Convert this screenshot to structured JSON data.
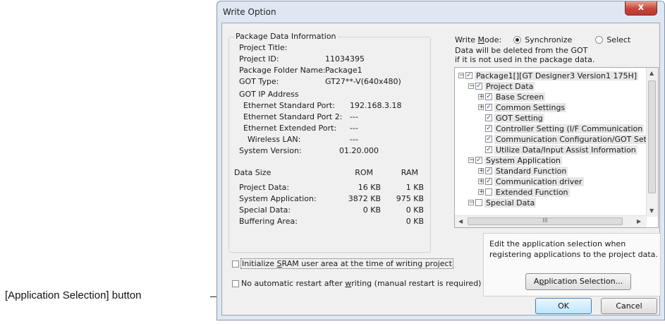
{
  "callout": {
    "text": "[Application Selection] button"
  },
  "dialog": {
    "title": "Write Option",
    "close": "x",
    "package_info": {
      "heading": "Package Data Information",
      "project_title_label": "Project Title:",
      "project_id_label": "Project ID:",
      "project_id_value": "11034395",
      "package_folder_label": "Package Folder Name:",
      "package_folder_value": "Package1",
      "got_type_label": "GOT Type:",
      "got_type_value": "GT27**-V(640x480)",
      "got_ip_label": "GOT IP Address",
      "eth_std_label": "Ethernet Standard Port:",
      "eth_std_value": "192.168.3.18",
      "eth_std2_label": "Ethernet Standard Port 2:",
      "eth_std2_value": "---",
      "eth_ext_label": "Ethernet Extended Port:",
      "eth_ext_value": "---",
      "wlan_label": "Wireless LAN:",
      "wlan_value": "---",
      "sysver_label": "System Version:",
      "sysver_value": "01.20.000"
    },
    "data_size": {
      "heading": "Data Size",
      "col_rom": "ROM",
      "col_ram": "RAM",
      "rows": [
        {
          "label": "Project Data:",
          "rom": "16 KB",
          "ram": "1 KB"
        },
        {
          "label": "System Application:",
          "rom": "3872 KB",
          "ram": "975 KB"
        },
        {
          "label": "Special Data:",
          "rom": "0 KB",
          "ram": "0 KB"
        },
        {
          "label": "Buffering Area:",
          "rom": "",
          "ram": "0 KB"
        }
      ]
    },
    "write_mode": {
      "label_pre": "Write ",
      "label_key": "M",
      "label_post": "ode:",
      "options": [
        "Synchronize",
        "Select"
      ],
      "selected": "Synchronize",
      "note_line1": "Data will be deleted from the GOT",
      "note_line2": "if it is not used in the package data."
    },
    "tree": [
      {
        "label": "Package1[][GT Designer3 Version1 175H]",
        "level": 0,
        "expander": "-",
        "checked": true
      },
      {
        "label": "Project Data",
        "level": 1,
        "expander": "-",
        "checked": true
      },
      {
        "label": "Base Screen",
        "level": 2,
        "expander": "+",
        "checked": true
      },
      {
        "label": "Common Settings",
        "level": 2,
        "expander": "+",
        "checked": true
      },
      {
        "label": "GOT Setting",
        "level": 2,
        "expander": "",
        "checked": true
      },
      {
        "label": "Controller Setting (I/F Communication",
        "level": 2,
        "expander": "",
        "checked": true
      },
      {
        "label": "Communication Configuration/GOT Set",
        "level": 2,
        "expander": "",
        "checked": true
      },
      {
        "label": "Utilize Data/Input Assist Information",
        "level": 2,
        "expander": "",
        "checked": true
      },
      {
        "label": "System Application",
        "level": 1,
        "expander": "-",
        "checked": true
      },
      {
        "label": "Standard Function",
        "level": 2,
        "expander": "+",
        "checked": true
      },
      {
        "label": "Communication driver",
        "level": 2,
        "expander": "+",
        "checked": true
      },
      {
        "label": "Extended Function",
        "level": 2,
        "expander": "+",
        "checked": false
      },
      {
        "label": "Special Data",
        "level": 1,
        "expander": "-",
        "checked": false
      }
    ],
    "scroll_thumb_grip": "III",
    "help_text": "Edit the application selection when registering applications to the project data.",
    "app_select_pre": "A",
    "app_select_key": "p",
    "app_select_post": "plication Selection...",
    "sram_pre": "Initialize ",
    "sram_key": "S",
    "sram_post": "RAM user area at the time of writing project",
    "restart_pre": "No automatic restart after ",
    "restart_key": "w",
    "restart_post": "riting (manual restart is required)",
    "ok": "OK",
    "cancel": "Cancel"
  }
}
